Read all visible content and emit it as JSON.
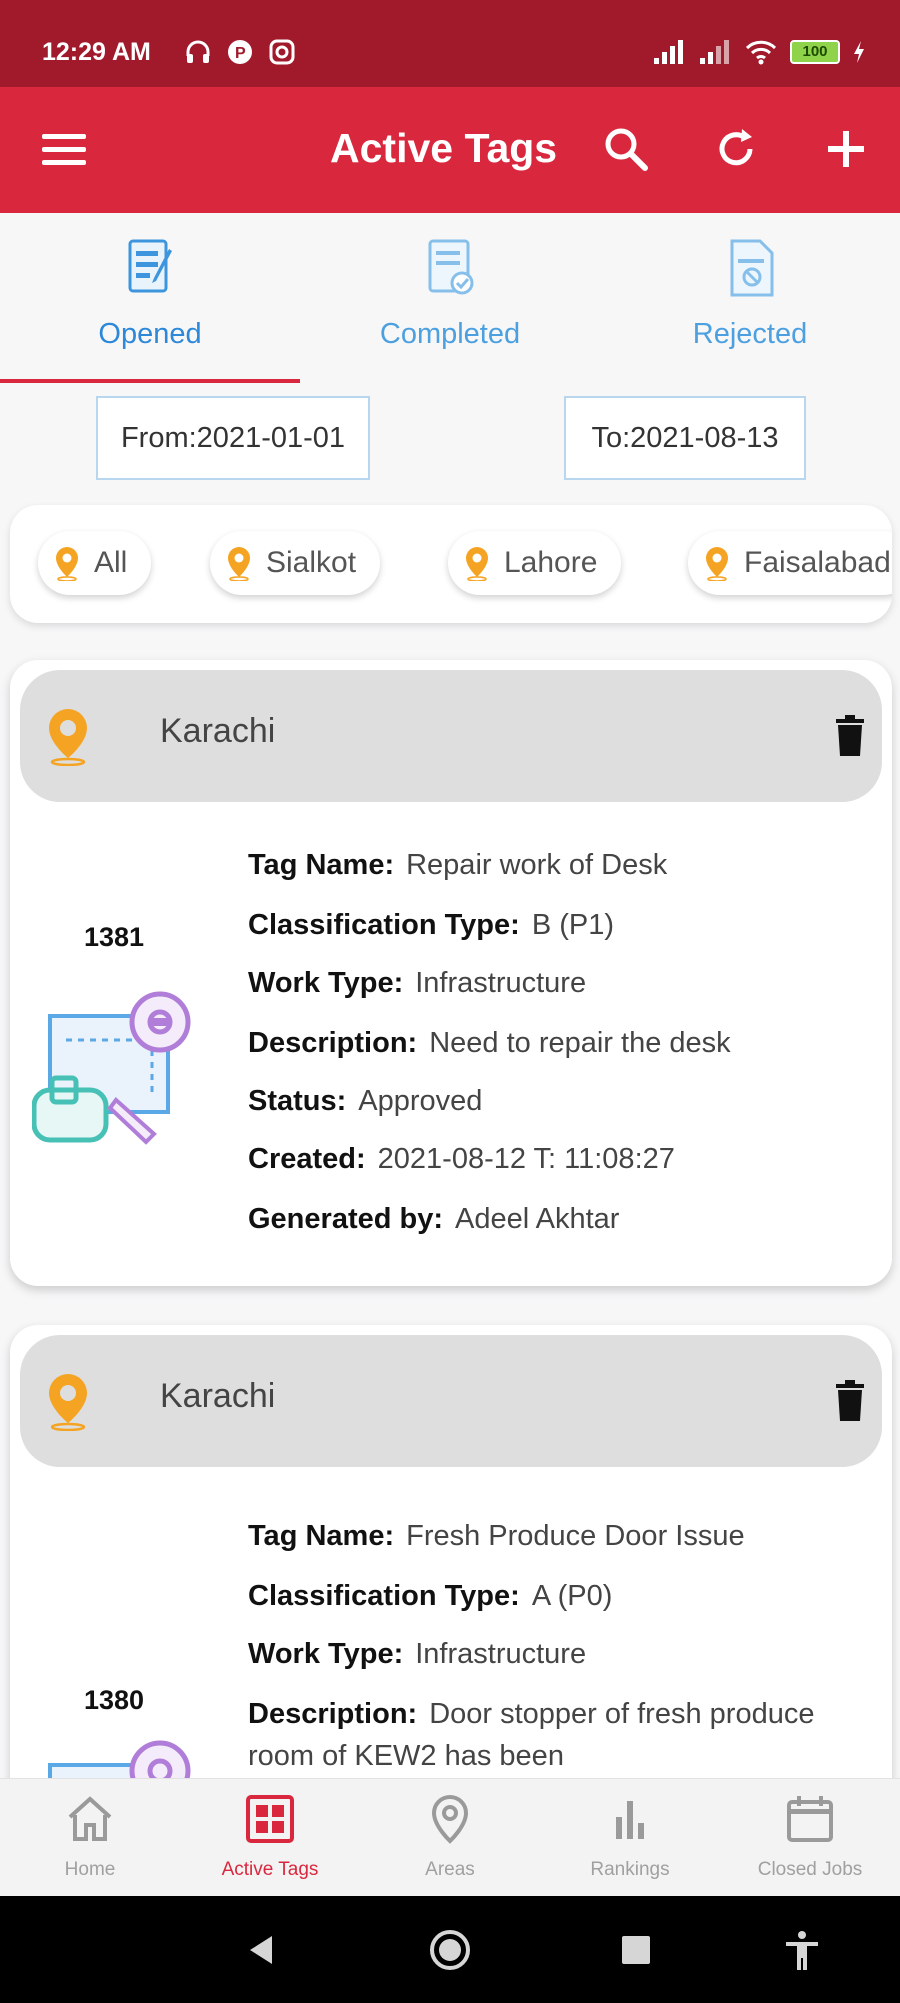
{
  "status_bar": {
    "time": "12:29 AM",
    "battery": "100"
  },
  "app_bar": {
    "title": "Active Tags",
    "icons": [
      "menu-icon",
      "search-icon",
      "refresh-icon",
      "add-icon"
    ]
  },
  "tabs": [
    {
      "label": "Opened",
      "icon": "opened-tags-icon",
      "active": true
    },
    {
      "label": "Completed",
      "icon": "completed-tags-icon",
      "active": false
    },
    {
      "label": "Rejected",
      "icon": "rejected-tags-icon",
      "active": false
    }
  ],
  "date_filter": {
    "from": "From:2021-01-01",
    "to": "To:2021-08-13"
  },
  "city_chips": [
    "All",
    "Sialkot",
    "Lahore",
    "Faisalabad"
  ],
  "cards": [
    {
      "city": "Karachi",
      "id": "1381",
      "fields": [
        {
          "label": "Tag Name:",
          "value": "Repair work of Desk"
        },
        {
          "label": "Classification Type:",
          "value": "B (P1)"
        },
        {
          "label": "Work Type:",
          "value": "Infrastructure"
        },
        {
          "label": "Description:",
          "value": "Need to repair the desk"
        },
        {
          "label": "Status:",
          "value": "Approved"
        },
        {
          "label": "Created:",
          "value": "2021-08-12 T: 11:08:27"
        },
        {
          "label": "Generated by:",
          "value": "Adeel Akhtar"
        }
      ]
    },
    {
      "city": "Karachi",
      "id": "1380",
      "fields": [
        {
          "label": "Tag Name:",
          "value": "Fresh Produce Door Issue"
        },
        {
          "label": "Classification Type:",
          "value": "A (P0)"
        },
        {
          "label": "Work Type:",
          "value": "Infrastructure"
        },
        {
          "label": "Description:",
          "value": "Door stopper of fresh produce room of KEW2 has been"
        }
      ]
    }
  ],
  "bottom_nav": [
    {
      "label": "Home",
      "icon": "home-icon",
      "active": false
    },
    {
      "label": "Active Tags",
      "icon": "active-tags-icon",
      "active": true
    },
    {
      "label": "Areas",
      "icon": "location-pin-icon",
      "active": false
    },
    {
      "label": "Rankings",
      "icon": "bar-chart-icon",
      "active": false
    },
    {
      "label": "Closed Jobs",
      "icon": "calendar-icon",
      "active": false
    }
  ],
  "colors": {
    "primary": "#d9283e",
    "status_bar": "#a01a2c",
    "tab_text": "#4da0e0",
    "pin": "#f4a422"
  }
}
